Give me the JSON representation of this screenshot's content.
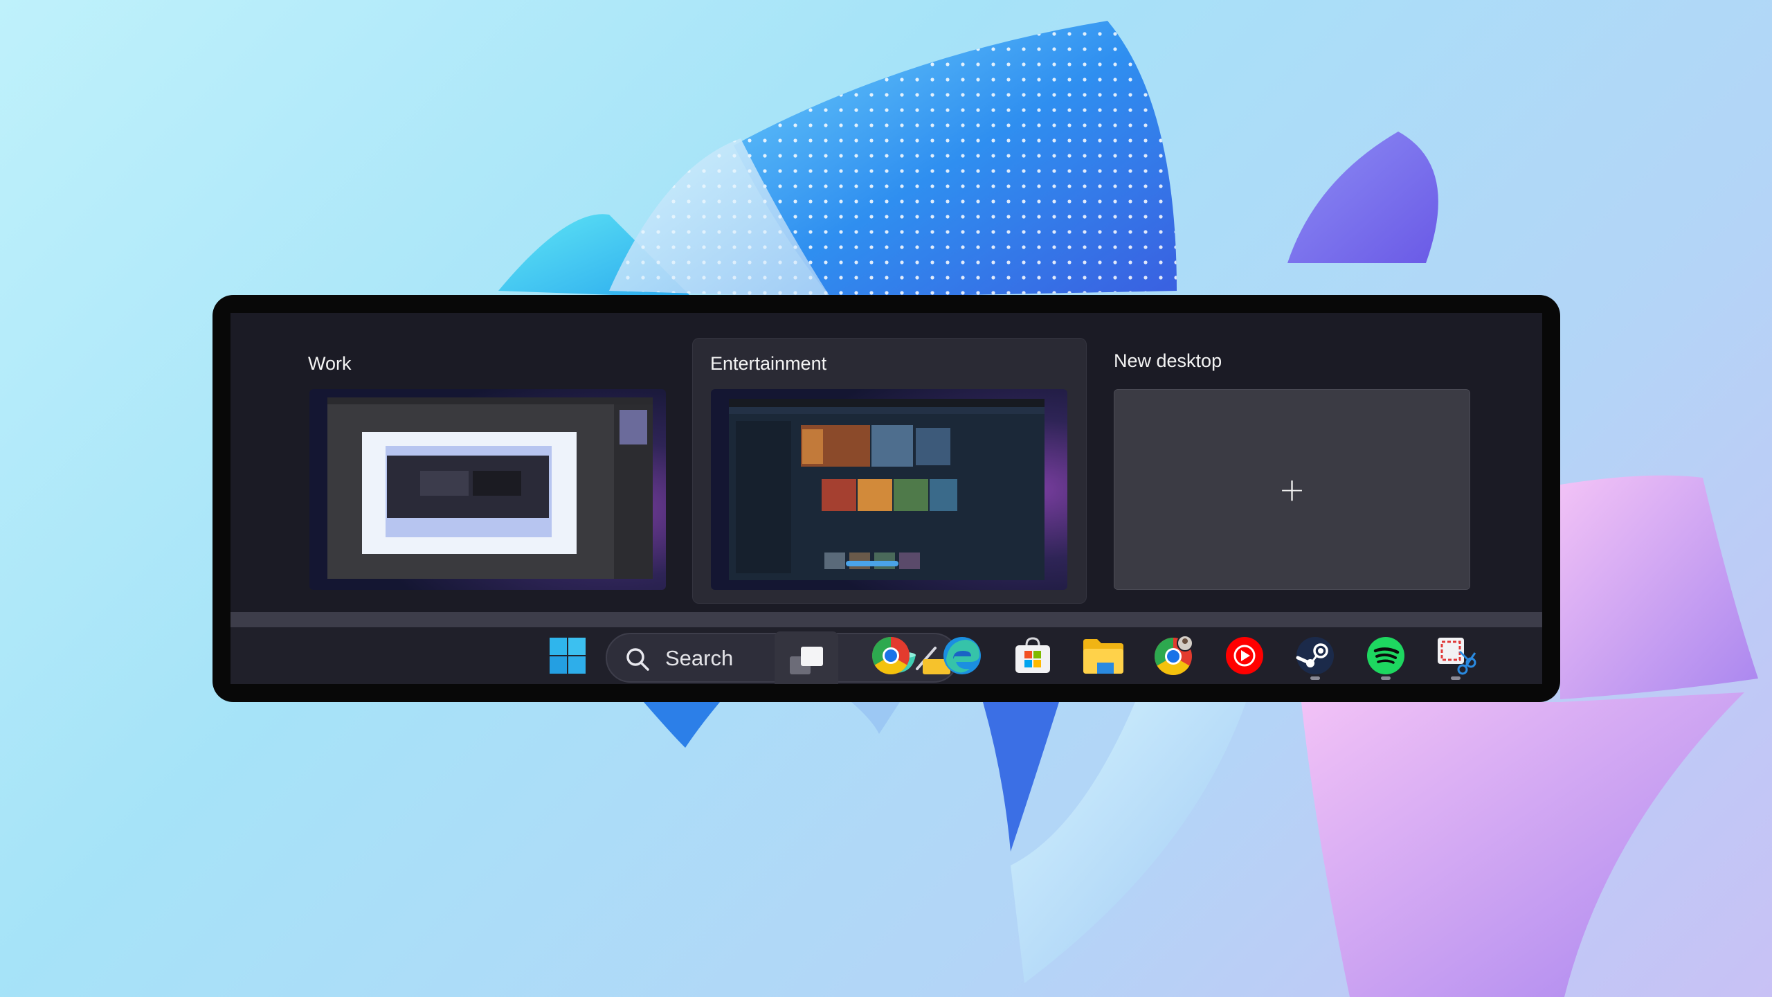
{
  "desktops": [
    {
      "name": "Work",
      "active": false
    },
    {
      "name": "Entertainment",
      "active": true
    },
    {
      "name": "New desktop",
      "active": false
    }
  ],
  "new_desktop_symbol": "+",
  "taskbar": {
    "search_placeholder": "Search",
    "apps": [
      {
        "name": "start-icon"
      },
      {
        "name": "task-view-icon"
      },
      {
        "name": "chrome-icon"
      },
      {
        "name": "edge-icon"
      },
      {
        "name": "microsoft-store-icon"
      },
      {
        "name": "file-explorer-icon"
      },
      {
        "name": "chrome-profile-icon"
      },
      {
        "name": "youtube-music-icon"
      },
      {
        "name": "steam-icon",
        "running": true
      },
      {
        "name": "spotify-icon",
        "running": true
      },
      {
        "name": "snipping-tool-icon",
        "running": true
      }
    ]
  },
  "colors": {
    "panel_frame": "#080808",
    "panel_bg": "#1b1b25",
    "taskbar_bg": "#20202a",
    "active_indicator": "#4aa3e8"
  }
}
